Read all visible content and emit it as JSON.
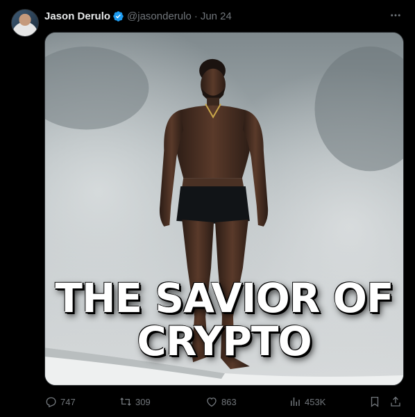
{
  "author": {
    "name": "Jason Derulo",
    "handle": "@jasonderulo",
    "separator": "·",
    "date": "Jun 24",
    "verified": true
  },
  "media": {
    "overlay_line1": "THE SAVIOR OF",
    "overlay_line2": "CRYPTO"
  },
  "actions": {
    "replies": "747",
    "reposts": "309",
    "likes": "863",
    "views": "453K"
  },
  "colors": {
    "background": "#000000",
    "text": "#e7e9ea",
    "muted": "#71767b",
    "verified": "#1d9bf0",
    "border": "#2f3336"
  },
  "icons": [
    "avatar",
    "verified-badge-icon",
    "more-icon",
    "reply-icon",
    "repost-icon",
    "like-icon",
    "views-icon",
    "bookmark-icon",
    "share-icon"
  ]
}
